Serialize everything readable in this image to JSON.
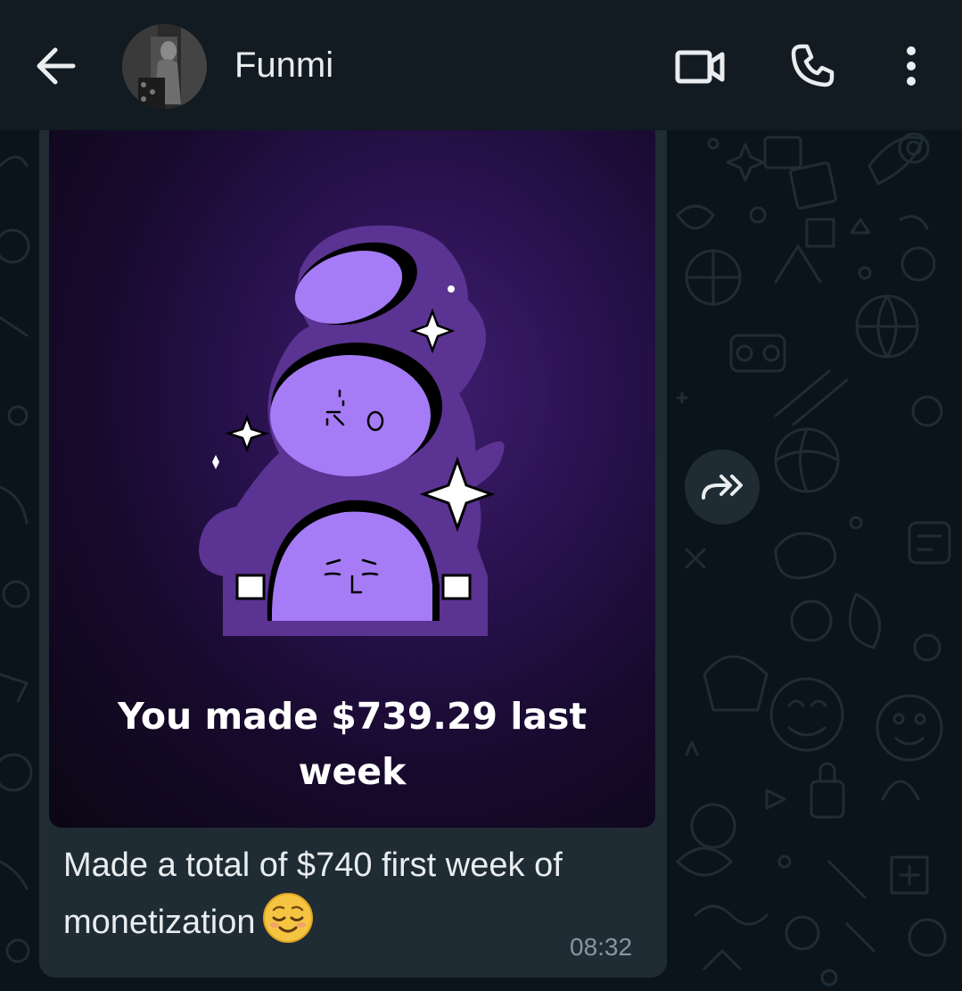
{
  "header": {
    "contact_name": "Funmi",
    "icons": {
      "back": "arrow-left-icon",
      "avatar": "profile-photo",
      "video": "video-call-icon",
      "call": "phone-icon",
      "menu": "more-vertical-icon"
    }
  },
  "message": {
    "image_caption_line1": "You made $739.29 last",
    "image_caption_line2": "week",
    "text": "Made a total of $740 first week of monetization",
    "emoji": "smiling-face-relieved",
    "time": "08:32"
  },
  "forward": {
    "icon": "forward-arrow-icon"
  },
  "colors": {
    "header_bg": "#111b21",
    "chat_bg": "#0b141a",
    "bubble_bg": "#1f2c34",
    "text_primary": "#e9edef",
    "text_secondary": "#8696a0",
    "sticker_purple": "#a57cf5",
    "sticker_outline": "#5b3392"
  }
}
